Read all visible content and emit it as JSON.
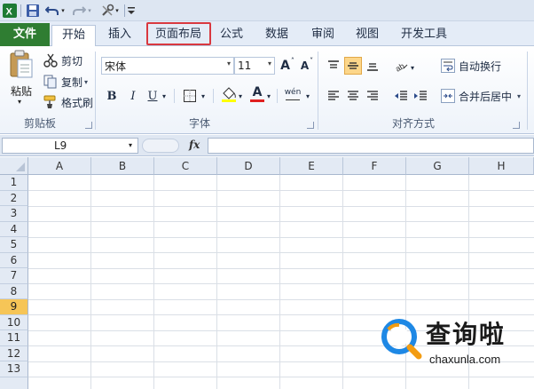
{
  "quick_access": {
    "icons": [
      "excel-icon",
      "save-icon",
      "undo-icon",
      "redo-icon",
      "tools-icon",
      "customize-icon"
    ]
  },
  "tabs": [
    {
      "label": "文件"
    },
    {
      "label": "开始"
    },
    {
      "label": "插入"
    },
    {
      "label": "页面布局"
    },
    {
      "label": "公式"
    },
    {
      "label": "数据"
    },
    {
      "label": "审阅"
    },
    {
      "label": "视图"
    },
    {
      "label": "开发工具"
    }
  ],
  "highlighted_tab": "页面布局",
  "colors": {
    "file_tab": "#2f7d32",
    "highlight_box": "#d9383f",
    "active_header": "#f6c557",
    "fill_color_bar": "#ffff00",
    "font_color_bar": "#e02020"
  },
  "ribbon": {
    "clipboard": {
      "paste_label": "粘贴",
      "cut_label": "剪切",
      "copy_label": "复制",
      "format_painter_label": "格式刷",
      "group_label": "剪贴板"
    },
    "font": {
      "font_name": "宋体",
      "font_size": "11",
      "bold": "B",
      "italic": "I",
      "underline": "U",
      "increase_size": "A",
      "decrease_size": "A",
      "font_color_letter": "A",
      "phonetic": "wén",
      "group_label": "字体"
    },
    "alignment": {
      "wrap_text_label": "自动换行",
      "merge_center_label": "合并后居中",
      "group_label": "对齐方式"
    }
  },
  "formula_bar": {
    "name_box": "L9",
    "fx": "fx",
    "formula": ""
  },
  "sheet": {
    "columns": [
      "A",
      "B",
      "C",
      "D",
      "E",
      "F",
      "G",
      "H"
    ],
    "rows": [
      "1",
      "2",
      "3",
      "4",
      "5",
      "6",
      "7",
      "8",
      "9",
      "10",
      "11",
      "12",
      "13"
    ],
    "active_row": "9"
  },
  "watermark": {
    "title": "查询啦",
    "url": "chaxunla.com"
  }
}
